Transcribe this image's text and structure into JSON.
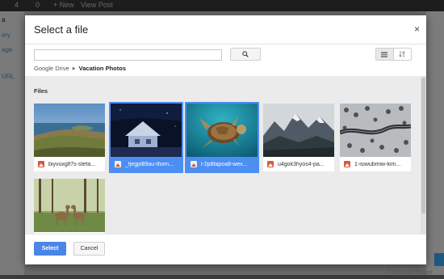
{
  "background": {
    "topbar_items": [
      "4",
      "0",
      "+ New",
      "View Post"
    ],
    "sidebar_items": [
      "a",
      "ery",
      "age",
      "URL"
    ],
    "bottom_text": "Featured image"
  },
  "dialog": {
    "title": "Select a file",
    "close_label": "×",
    "search": {
      "value": "",
      "placeholder": ""
    },
    "breadcrumb": {
      "root": "Google Drive",
      "current": "Vacation Photos"
    },
    "files_heading": "Files",
    "files": [
      {
        "name": "biyvuxglf7s-stefa...",
        "selected": false
      },
      {
        "name": "_fjegpl89au-thom...",
        "selected": true
      },
      {
        "name": "l-2p8fapoa8-wex...",
        "selected": true
      },
      {
        "name": "u4gok3hyos4-pa...",
        "selected": false
      },
      {
        "name": "1-isiwubmiw-kim...",
        "selected": false
      },
      {
        "name": "",
        "selected": false
      }
    ],
    "footer": {
      "select_label": "Select",
      "cancel_label": "Cancel"
    }
  },
  "colors": {
    "accent": "#4a86e8",
    "selected_label": "#4d8ef3",
    "image_icon": "#d65a3a"
  },
  "icons": {
    "search": "magnifier-icon",
    "grid_view": "grid-view-icon",
    "list_view": "sort-icon"
  }
}
